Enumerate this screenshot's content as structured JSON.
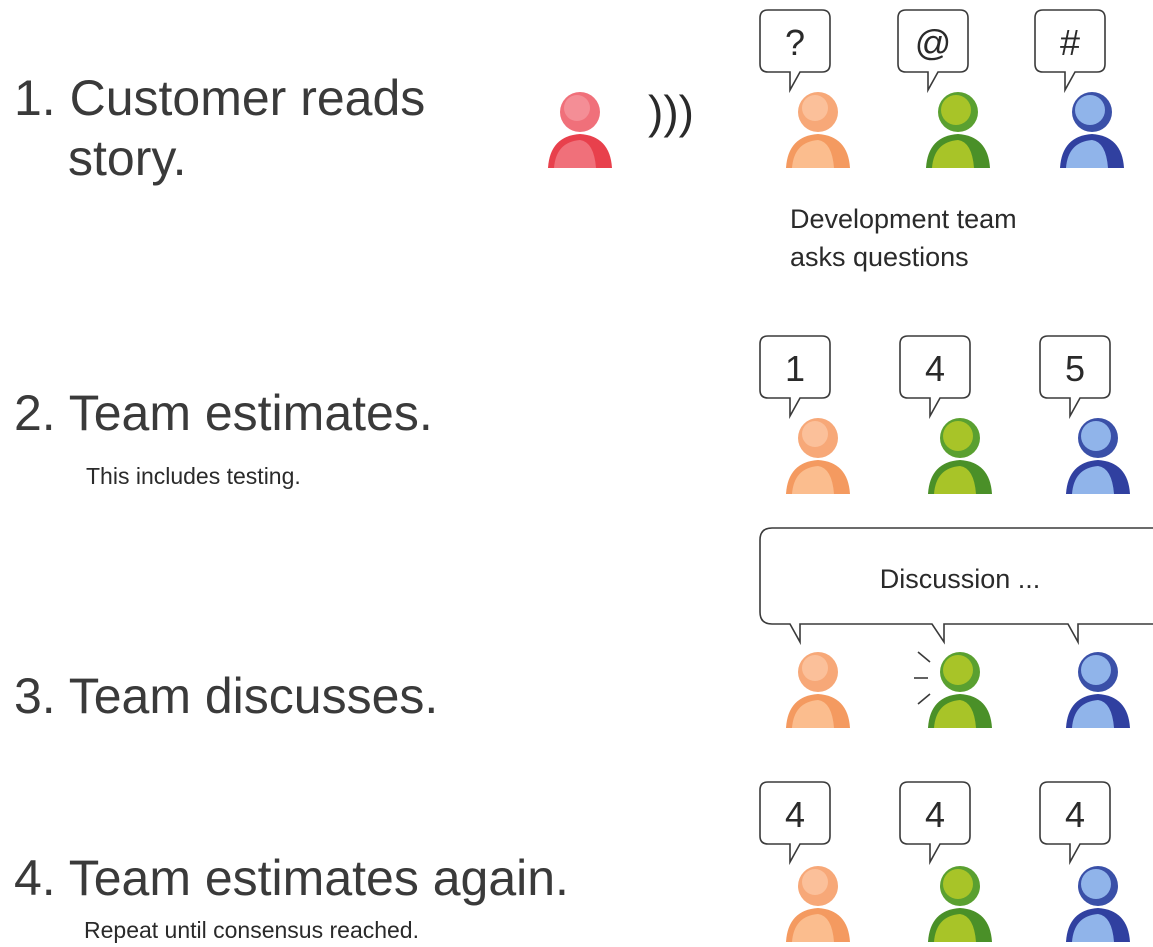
{
  "steps": [
    {
      "number": "1.",
      "title": "Customer reads",
      "title_line2": "story.",
      "subtitle": ""
    },
    {
      "number": "2.",
      "title": "Team estimates.",
      "subtitle": "This includes testing."
    },
    {
      "number": "3.",
      "title": "Team discusses.",
      "subtitle": ""
    },
    {
      "number": "4.",
      "title": "Team estimates again.",
      "subtitle": "Repeat until consensus reached."
    }
  ],
  "row1": {
    "speech_symbol": ")))",
    "bubbles": [
      "?",
      "@",
      "#"
    ],
    "caption_line1": "Development team",
    "caption_line2": "asks questions"
  },
  "row2": {
    "bubbles": [
      "1",
      "4",
      "5"
    ]
  },
  "row3": {
    "discussion_text": "Discussion ..."
  },
  "row4": {
    "bubbles": [
      "4",
      "4",
      "4"
    ]
  },
  "colors": {
    "customer": "#e8404c",
    "orange_person": "#f7a878",
    "green_person": "#9ab820",
    "blue_person": "#80a8e0"
  }
}
